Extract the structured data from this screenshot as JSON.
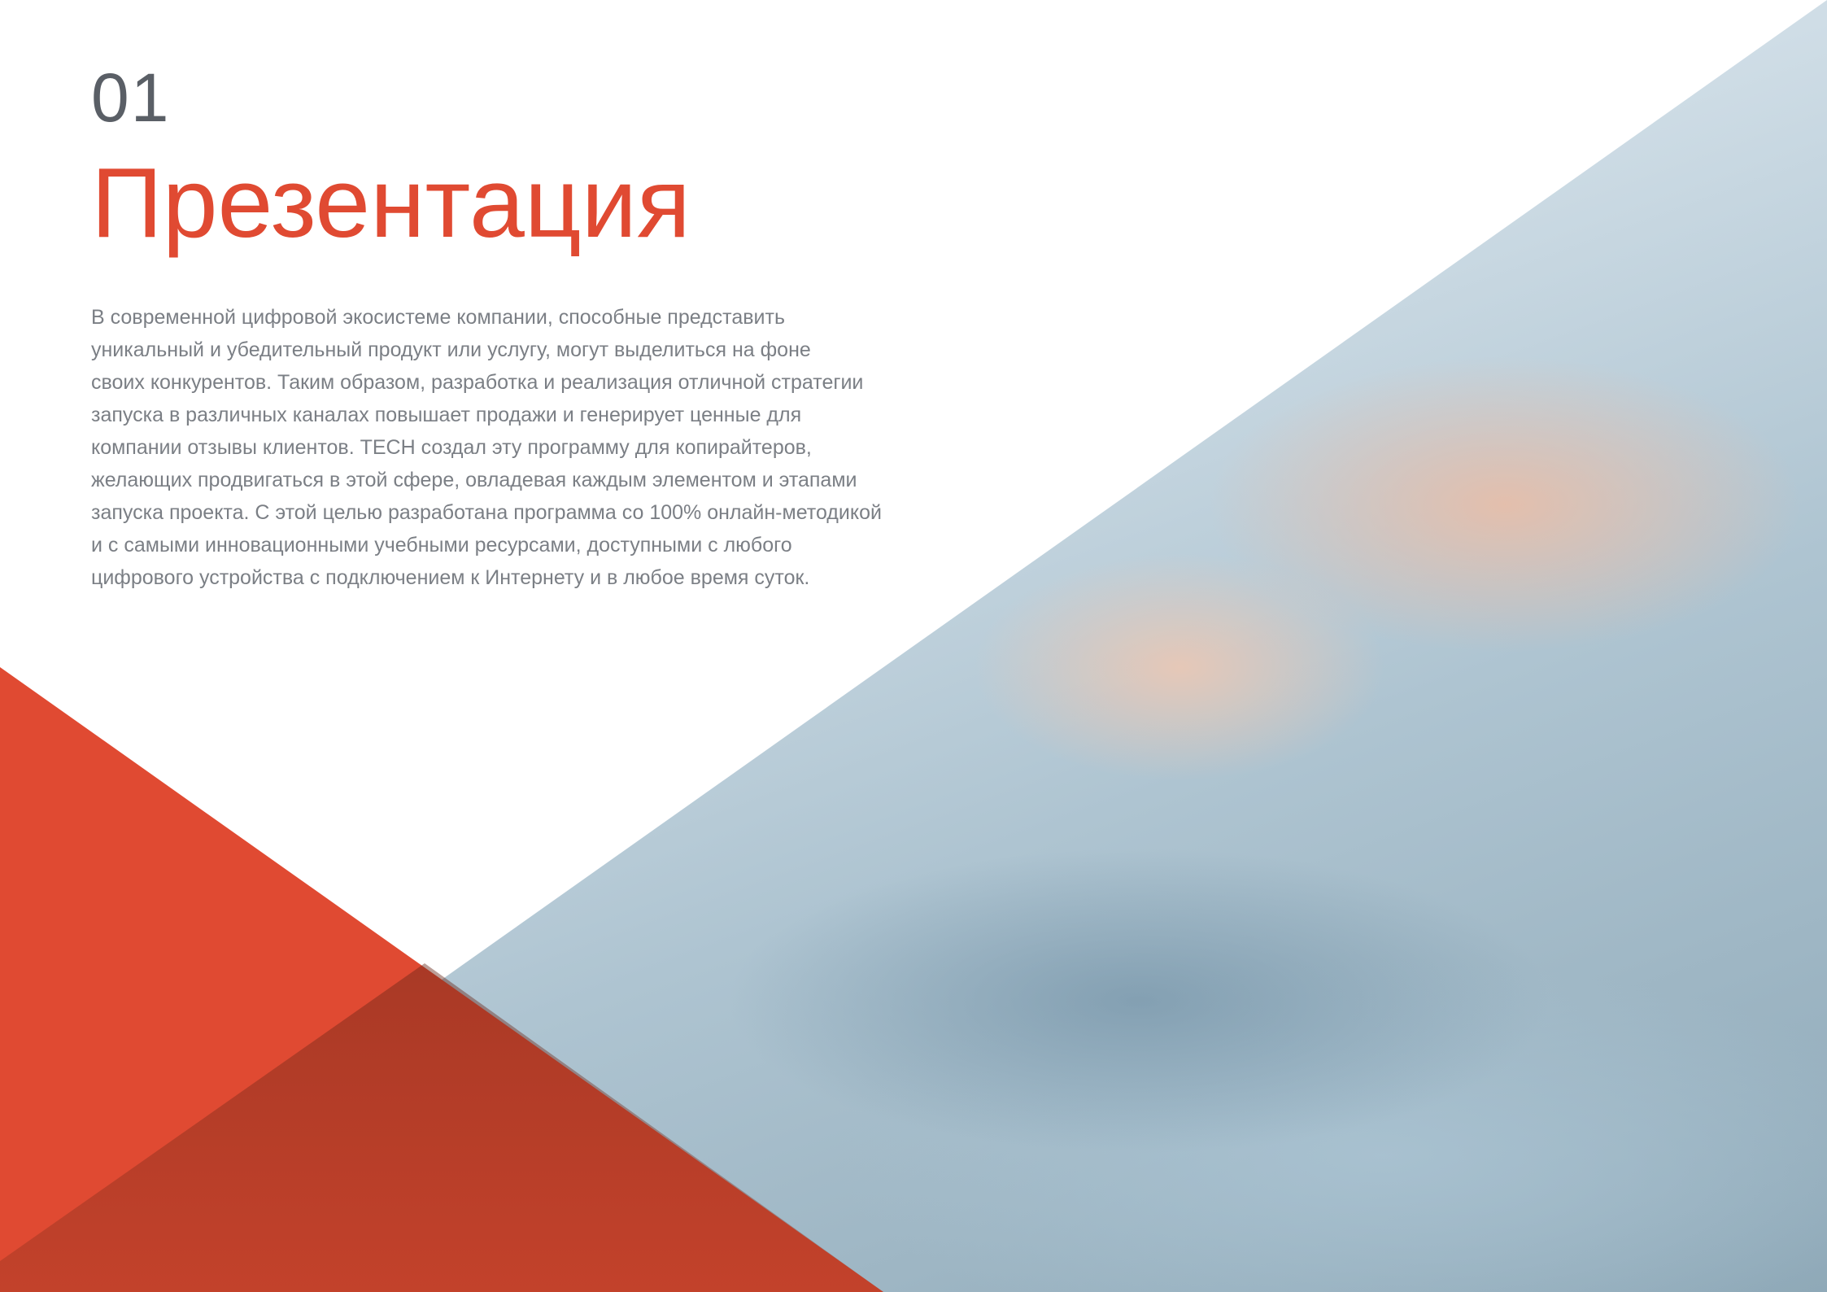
{
  "section": {
    "number": "01",
    "title": "Презентация"
  },
  "body": {
    "lines": [
      "В современной цифровой экосистеме компании, способные представить",
      "уникальный и убедительный продукт или услугу, могут выделиться на фоне",
      "своих конкурентов. Таким образом, разработка и реализация отличной стратегии",
      "запуска в различных каналах повышает продажи и генерирует ценные для",
      "компании отзывы клиентов. TECH создал эту программу для копирайтеров,",
      "желающих продвигаться в этой сфере, овладевая каждым элементом и этапами",
      "запуска проекта. С этой целью разработана программа со 100% онлайн-методикой",
      "и с самыми инновационными учебными ресурсами, доступными с любого",
      "цифрового устройства с подключением к Интернету и в любое время суток."
    ]
  },
  "colors": {
    "accent": "#e04a32",
    "number": "#5a5f66",
    "text": "#7b7f85"
  }
}
